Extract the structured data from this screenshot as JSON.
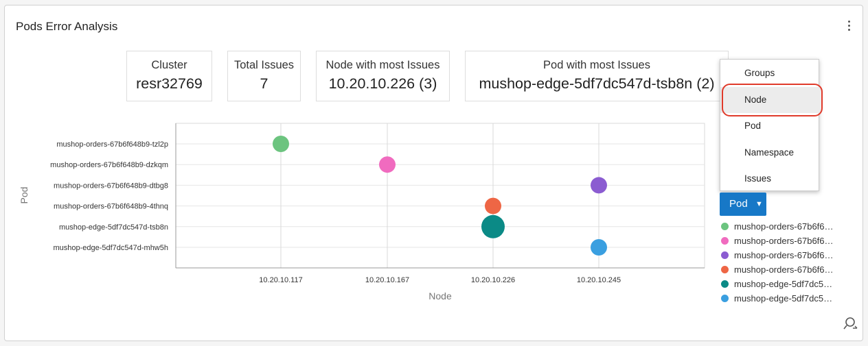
{
  "panel": {
    "title": "Pods Error Analysis"
  },
  "stats": {
    "cluster": {
      "label": "Cluster",
      "value": "resr32769"
    },
    "total_issues": {
      "label": "Total Issues",
      "value": "7"
    },
    "node_most": {
      "label": "Node with most Issues",
      "value": "10.20.10.226 (3)"
    },
    "pod_most": {
      "label": "Pod with most Issues",
      "value": "mushop-edge-5df7dc547d-tsb8n (2)"
    }
  },
  "menu": {
    "items": [
      "Groups",
      "Node",
      "Pod",
      "Namespace",
      "Issues"
    ],
    "highlighted": "Node"
  },
  "group_button": {
    "label": "Pod",
    "caret": "▼"
  },
  "legend": {
    "items": [
      {
        "label": "mushop-orders-67b6f6…",
        "color": "#6cc47f"
      },
      {
        "label": "mushop-orders-67b6f6…",
        "color": "#f06bbf"
      },
      {
        "label": "mushop-orders-67b6f6…",
        "color": "#8b5cd1"
      },
      {
        "label": "mushop-orders-67b6f6…",
        "color": "#ee6645"
      },
      {
        "label": "mushop-edge-5df7dc5…",
        "color": "#0b8a86"
      },
      {
        "label": "mushop-edge-5df7dc5…",
        "color": "#3a9fe0"
      }
    ]
  },
  "icons": {
    "menu": "kebab-icon",
    "zoom": "zoom-icon"
  },
  "chart_data": {
    "type": "scatter",
    "xlabel": "Node",
    "ylabel": "Pod",
    "x_categories": [
      "10.20.10.117",
      "10.20.10.167",
      "10.20.10.226",
      "10.20.10.245"
    ],
    "y_categories": [
      "mushop-orders-67b6f648b9-tzl2p",
      "mushop-orders-67b6f648b9-dzkqm",
      "mushop-orders-67b6f648b9-dtbg8",
      "mushop-orders-67b6f648b9-4thnq",
      "mushop-edge-5df7dc547d-tsb8n",
      "mushop-edge-5df7dc547d-mhw5h"
    ],
    "points": [
      {
        "x": "10.20.10.117",
        "y": "mushop-orders-67b6f648b9-tzl2p",
        "issues": 1,
        "color": "#6cc47f"
      },
      {
        "x": "10.20.10.167",
        "y": "mushop-orders-67b6f648b9-dzkqm",
        "issues": 1,
        "color": "#f06bbf"
      },
      {
        "x": "10.20.10.245",
        "y": "mushop-orders-67b6f648b9-dtbg8",
        "issues": 1,
        "color": "#8b5cd1"
      },
      {
        "x": "10.20.10.226",
        "y": "mushop-orders-67b6f648b9-4thnq",
        "issues": 1,
        "color": "#ee6645"
      },
      {
        "x": "10.20.10.226",
        "y": "mushop-edge-5df7dc547d-tsb8n",
        "issues": 2,
        "color": "#0b8a86"
      },
      {
        "x": "10.20.10.245",
        "y": "mushop-edge-5df7dc547d-mhw5h",
        "issues": 1,
        "color": "#3a9fe0"
      }
    ]
  }
}
